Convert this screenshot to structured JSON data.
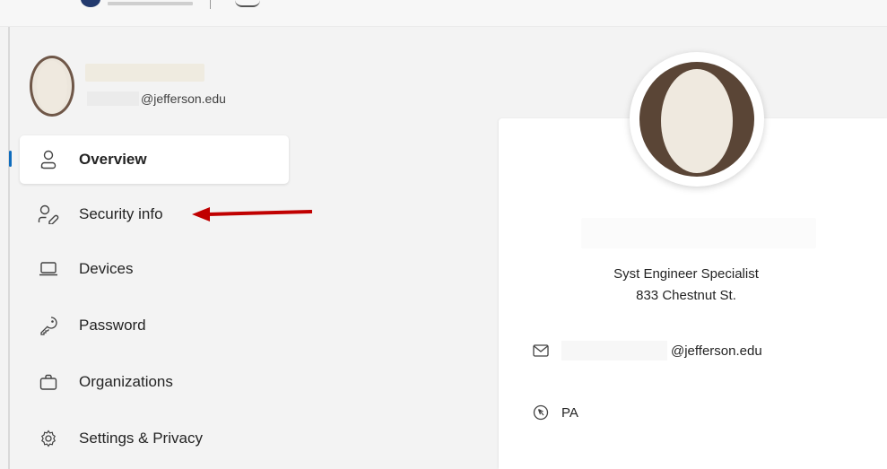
{
  "user": {
    "email_domain": "@jefferson.edu"
  },
  "nav": {
    "items": [
      {
        "label": "Overview",
        "icon": "person-icon",
        "active": true
      },
      {
        "label": "Security info",
        "icon": "person-key-icon",
        "active": false
      },
      {
        "label": "Devices",
        "icon": "laptop-icon",
        "active": false
      },
      {
        "label": "Password",
        "icon": "key-icon",
        "active": false
      },
      {
        "label": "Organizations",
        "icon": "briefcase-icon",
        "active": false
      },
      {
        "label": "Settings & Privacy",
        "icon": "gear-icon",
        "active": false
      }
    ]
  },
  "profile": {
    "job_title": "Syst Engineer Specialist",
    "address": "833 Chestnut St.",
    "email_domain": "@jefferson.edu",
    "location": "PA"
  },
  "colors": {
    "accent": "#0f6cbd",
    "annotation_arrow": "#c00000",
    "background": "#f3f3f3"
  }
}
